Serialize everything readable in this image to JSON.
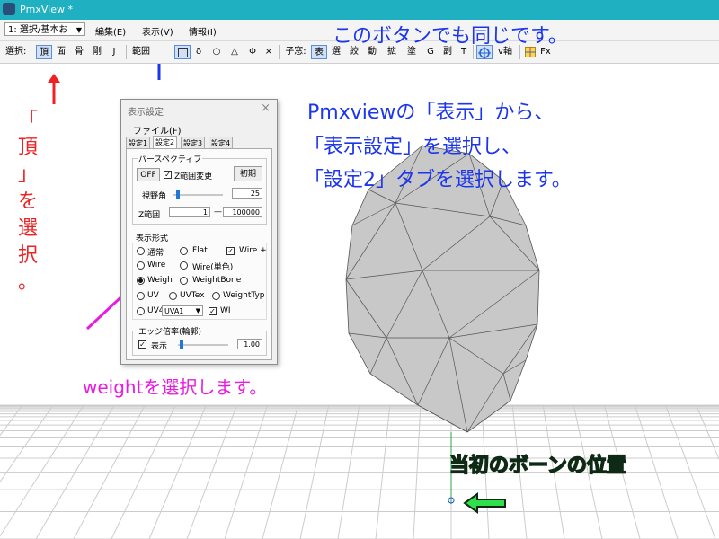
{
  "window": {
    "title": "PmxView *",
    "accent": "#1fb0c2"
  },
  "menubar": {
    "mode_select": "1: 選択/基本お",
    "items": [
      "編集(E)",
      "表示(V)",
      "情報(I)"
    ]
  },
  "toolbar": {
    "select_label": "選択:",
    "select_buttons": [
      "頂",
      "面",
      "骨",
      "剛",
      "J"
    ],
    "range_label": "範囲",
    "shape_buttons": [
      "δ",
      "○",
      "△",
      "Φ",
      "×"
    ],
    "window_label": "子窓:",
    "window_buttons": [
      "表",
      "選",
      "絞",
      "動",
      "拡",
      "塗",
      "G",
      "副",
      "T"
    ],
    "v_axis_label": "v軸",
    "fx_label": "Fx"
  },
  "dialog": {
    "title": "表示設定",
    "close": "×",
    "menu_file": "ファイル(F)",
    "tabs": [
      "設定1",
      "設定2",
      "設定3",
      "設定4"
    ],
    "active_tab": 1,
    "perspective": {
      "label": "パースペクティブ",
      "off_button": "OFF",
      "zrange_change": "Z範囲変更",
      "zrange_change_checked": true,
      "reset_button": "初期",
      "fov_label": "視野角",
      "fov_value": "25",
      "zrange_label": "Z範囲",
      "z_min": "1",
      "z_dash": "—",
      "z_max": "100000"
    },
    "display_format": {
      "label": "表示形式",
      "options": {
        "normal": "通常",
        "flat": "Flat",
        "wire_plus": "Wire +",
        "wire": "Wire",
        "wire_mono": "Wire(単色)",
        "weight": "Weigh",
        "weight_bone": "WeightBone",
        "uv": "UV",
        "uvtex": "UVTex",
        "weight_type": "WeightTyp",
        "uv4": "UV4",
        "uv_combo": "UVA1",
        "wi": "WI"
      },
      "selected": "weight",
      "wire_plus_checked": true,
      "wi_checked": true
    },
    "edge": {
      "label": "エッジ倍率(輪郭)",
      "show_label": "表示",
      "show_checked": true,
      "value": "1.00"
    }
  },
  "annotations": {
    "top_button_note": "このボタンでも同じです。",
    "pmxview_instructions": [
      "Pmxviewの「表示」から、",
      "「表示設定」を選択し、",
      "「設定2」タブを選択します。"
    ],
    "vertex_note_chars": [
      "「",
      "頂",
      "」",
      "を",
      "選",
      "択",
      "。"
    ],
    "weight_note": "weightを選択します。",
    "bone_note": "当初のボーンの位置",
    "colors": {
      "blue": "#1c36ee",
      "red": "#ee2222",
      "magenta": "#e81ce0",
      "green": "#2fe04c"
    }
  }
}
